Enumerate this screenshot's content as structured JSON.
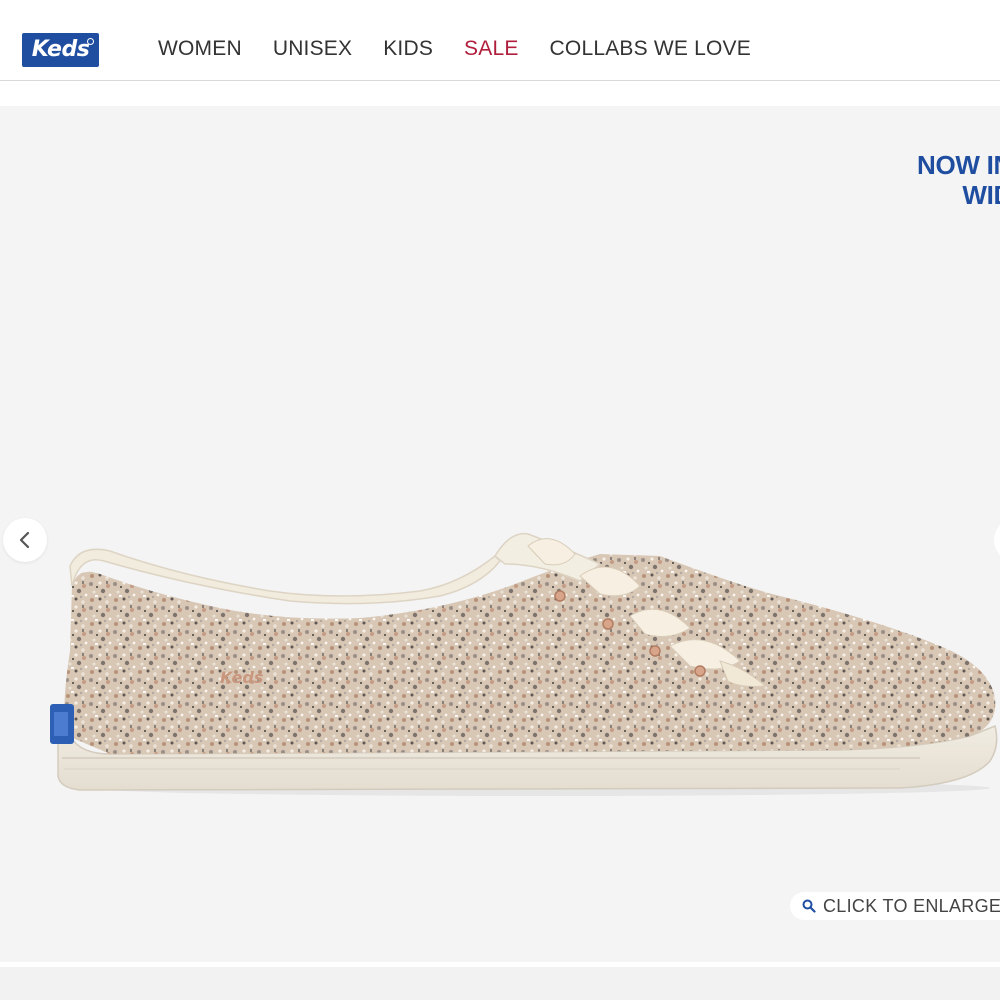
{
  "brand": {
    "logo_text": "Keds",
    "logo_color": "#1f4ea1"
  },
  "nav": {
    "items": [
      {
        "label": "WOMEN"
      },
      {
        "label": "UNISEX"
      },
      {
        "label": "KIDS"
      },
      {
        "label": "SALE"
      },
      {
        "label": "COLLABS WE LOVE"
      }
    ],
    "sale_color": "#b01e3c"
  },
  "gallery": {
    "promo_line1": "NOW IN",
    "promo_line2": "WID",
    "promo_color": "#1f4ea1",
    "prev_icon": "chevron-left-icon",
    "enlarge_label": "CLICK TO ENLARGE",
    "enlarge_icon": "search-icon",
    "product_image_alt": "glitter sneaker with satin laces",
    "product_label_text": "Keds"
  }
}
